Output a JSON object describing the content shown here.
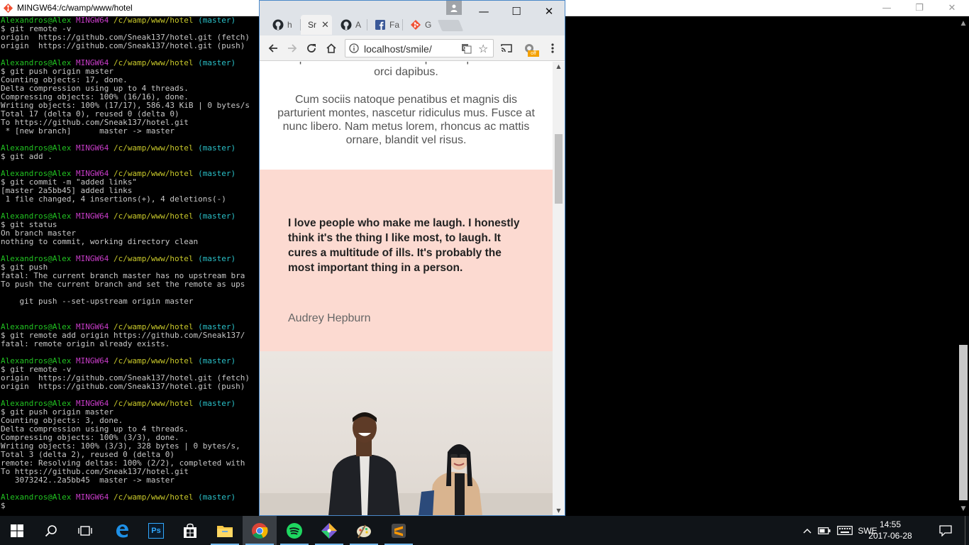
{
  "terminal": {
    "title": "MINGW64:/c/wamp/www/hotel",
    "lines": [
      [
        {
          "t": "Alexandros@Alex ",
          "c": "g"
        },
        {
          "t": "MINGW64 ",
          "c": "m"
        },
        {
          "t": "/c/wamp/www/hotel ",
          "c": "y"
        },
        {
          "t": "(master)",
          "c": "c"
        }
      ],
      [
        {
          "t": "$ git remote -v"
        }
      ],
      [
        {
          "t": "origin  https://github.com/Sneak137/hotel.git (fetch)"
        }
      ],
      [
        {
          "t": "origin  https://github.com/Sneak137/hotel.git (push)"
        }
      ],
      [],
      [
        {
          "t": "Alexandros@Alex ",
          "c": "g"
        },
        {
          "t": "MINGW64 ",
          "c": "m"
        },
        {
          "t": "/c/wamp/www/hotel ",
          "c": "y"
        },
        {
          "t": "(master)",
          "c": "c"
        }
      ],
      [
        {
          "t": "$ git push origin master"
        }
      ],
      [
        {
          "t": "Counting objects: 17, done."
        }
      ],
      [
        {
          "t": "Delta compression using up to 4 threads."
        }
      ],
      [
        {
          "t": "Compressing objects: 100% (16/16), done."
        }
      ],
      [
        {
          "t": "Writing objects: 100% (17/17), 586.43 KiB | 0 bytes/s"
        }
      ],
      [
        {
          "t": "Total 17 (delta 0), reused 0 (delta 0)"
        }
      ],
      [
        {
          "t": "To https://github.com/Sneak137/hotel.git"
        }
      ],
      [
        {
          "t": " * [new branch]      master -> master"
        }
      ],
      [],
      [
        {
          "t": "Alexandros@Alex ",
          "c": "g"
        },
        {
          "t": "MINGW64 ",
          "c": "m"
        },
        {
          "t": "/c/wamp/www/hotel ",
          "c": "y"
        },
        {
          "t": "(master)",
          "c": "c"
        }
      ],
      [
        {
          "t": "$ git add ."
        }
      ],
      [],
      [
        {
          "t": "Alexandros@Alex ",
          "c": "g"
        },
        {
          "t": "MINGW64 ",
          "c": "m"
        },
        {
          "t": "/c/wamp/www/hotel ",
          "c": "y"
        },
        {
          "t": "(master)",
          "c": "c"
        }
      ],
      [
        {
          "t": "$ git commit -m \"added links\""
        }
      ],
      [
        {
          "t": "[master 2a5bb45] added links"
        }
      ],
      [
        {
          "t": " 1 file changed, 4 insertions(+), 4 deletions(-)"
        }
      ],
      [],
      [
        {
          "t": "Alexandros@Alex ",
          "c": "g"
        },
        {
          "t": "MINGW64 ",
          "c": "m"
        },
        {
          "t": "/c/wamp/www/hotel ",
          "c": "y"
        },
        {
          "t": "(master)",
          "c": "c"
        }
      ],
      [
        {
          "t": "$ git status"
        }
      ],
      [
        {
          "t": "On branch master"
        }
      ],
      [
        {
          "t": "nothing to commit, working directory clean"
        }
      ],
      [],
      [
        {
          "t": "Alexandros@Alex ",
          "c": "g"
        },
        {
          "t": "MINGW64 ",
          "c": "m"
        },
        {
          "t": "/c/wamp/www/hotel ",
          "c": "y"
        },
        {
          "t": "(master)",
          "c": "c"
        }
      ],
      [
        {
          "t": "$ git push"
        }
      ],
      [
        {
          "t": "fatal: The current branch master has no upstream bra"
        }
      ],
      [
        {
          "t": "To push the current branch and set the remote as ups"
        }
      ],
      [],
      [
        {
          "t": "    git push --set-upstream origin master"
        }
      ],
      [],
      [],
      [
        {
          "t": "Alexandros@Alex ",
          "c": "g"
        },
        {
          "t": "MINGW64 ",
          "c": "m"
        },
        {
          "t": "/c/wamp/www/hotel ",
          "c": "y"
        },
        {
          "t": "(master)",
          "c": "c"
        }
      ],
      [
        {
          "t": "$ git remote add origin https://github.com/Sneak137/"
        }
      ],
      [
        {
          "t": "fatal: remote origin already exists."
        }
      ],
      [],
      [
        {
          "t": "Alexandros@Alex ",
          "c": "g"
        },
        {
          "t": "MINGW64 ",
          "c": "m"
        },
        {
          "t": "/c/wamp/www/hotel ",
          "c": "y"
        },
        {
          "t": "(master)",
          "c": "c"
        }
      ],
      [
        {
          "t": "$ git remote -v"
        }
      ],
      [
        {
          "t": "origin  https://github.com/Sneak137/hotel.git (fetch)"
        }
      ],
      [
        {
          "t": "origin  https://github.com/Sneak137/hotel.git (push)"
        }
      ],
      [],
      [
        {
          "t": "Alexandros@Alex ",
          "c": "g"
        },
        {
          "t": "MINGW64 ",
          "c": "m"
        },
        {
          "t": "/c/wamp/www/hotel ",
          "c": "y"
        },
        {
          "t": "(master)",
          "c": "c"
        }
      ],
      [
        {
          "t": "$ git push origin master"
        }
      ],
      [
        {
          "t": "Counting objects: 3, done."
        }
      ],
      [
        {
          "t": "Delta compression using up to 4 threads."
        }
      ],
      [
        {
          "t": "Compressing objects: 100% (3/3), done."
        }
      ],
      [
        {
          "t": "Writing objects: 100% (3/3), 328 bytes | 0 bytes/s,"
        }
      ],
      [
        {
          "t": "Total 3 (delta 2), reused 0 (delta 0)"
        }
      ],
      [
        {
          "t": "remote: Resolving deltas: 100% (2/2), completed with"
        }
      ],
      [
        {
          "t": "To https://github.com/Sneak137/hotel.git"
        }
      ],
      [
        {
          "t": "   3073242..2a5bb45  master -> master"
        }
      ],
      [],
      [
        {
          "t": "Alexandros@Alex ",
          "c": "g"
        },
        {
          "t": "MINGW64 ",
          "c": "m"
        },
        {
          "t": "/c/wamp/www/hotel ",
          "c": "y"
        },
        {
          "t": "(master)",
          "c": "c"
        }
      ],
      [
        {
          "t": "$ "
        }
      ]
    ]
  },
  "browser": {
    "tabs": [
      {
        "label": "h",
        "icon": "github-icon"
      },
      {
        "label": "Sr",
        "icon": "none"
      },
      {
        "label": "A",
        "icon": "github-icon"
      },
      {
        "label": "Fa",
        "icon": "facebook-icon"
      },
      {
        "label": "G",
        "icon": "git-icon"
      }
    ],
    "url": "localhost/smile/",
    "extension_badge": "off"
  },
  "page": {
    "para_top": "Sed pharetra erat vitae dui imperdiet quis commodo orci dapibus.",
    "para_main": "Cum sociis natoque penatibus et magnis dis parturient montes, nascetur ridiculus mus. Fusce at nunc libero. Nam metus lorem, rhoncus ac mattis ornare, blandit vel risus.",
    "quote": "I love people who make me laugh. I honestly think it's the thing I like most, to laugh. It cures a multitude of ills. It's probably the most important thing in a person.",
    "author": "Audrey Hepburn"
  },
  "taskbar": {
    "language": "SWE",
    "time": "14:55",
    "date": "2017-06-28",
    "apps": [
      "start-button",
      "search-icon",
      "task-view-icon",
      "edge-icon",
      "photoshop-icon",
      "store-icon",
      "file-explorer-icon",
      "chrome-icon",
      "spotify-icon",
      "git-icon",
      "paint-icon",
      "sublime-text-icon"
    ],
    "photoshop_label": "Ps"
  }
}
